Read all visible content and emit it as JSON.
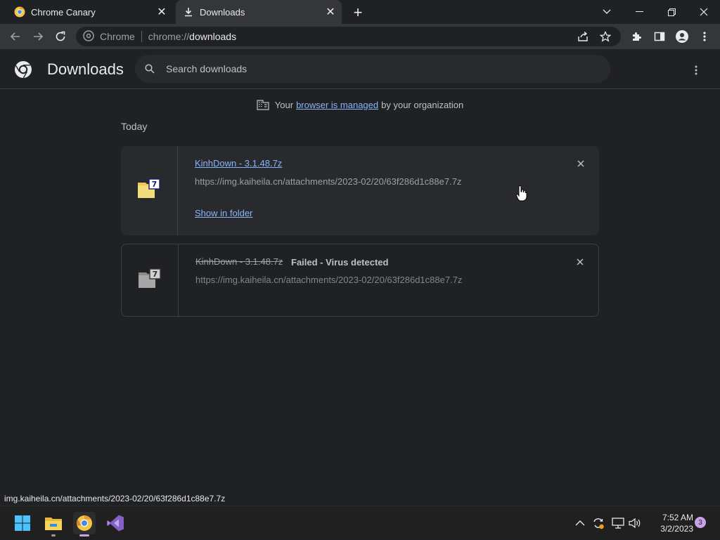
{
  "tabs": [
    {
      "title": "Chrome Canary",
      "favicon": "chrome-canary-icon",
      "active": false
    },
    {
      "title": "Downloads",
      "favicon": "download-icon",
      "active": true
    }
  ],
  "omnibox": {
    "site_label": "Chrome",
    "url_scheme": "chrome://",
    "url_host": "downloads"
  },
  "header": {
    "title": "Downloads",
    "search_placeholder": "Search downloads"
  },
  "managed": {
    "prefix": "Your",
    "link": "browser is managed",
    "suffix": "by your organization"
  },
  "section_label": "Today",
  "downloads": [
    {
      "file_name": "KinhDown - 3.1.48.7z",
      "url": "https://img.kaiheila.cn/attachments/2023-02/20/63f286d1c88e7.7z",
      "action": "Show in folder",
      "status": ""
    },
    {
      "file_name": "KinhDown - 3.1.48.7z",
      "url": "https://img.kaiheila.cn/attachments/2023-02/20/63f286d1c88e7.7z",
      "status": "Failed - Virus detected"
    }
  ],
  "status_bar": "img.kaiheila.cn/attachments/2023-02/20/63f286d1c88e7.7z",
  "taskbar": {
    "apps": [
      "windows-start-icon",
      "file-explorer-icon",
      "chrome-canary-icon",
      "visual-studio-icon"
    ],
    "time": "7:52 AM",
    "date": "3/2/2023",
    "notification_count": "3"
  },
  "colors": {
    "accent": "#8ab4f8",
    "background": "#202124",
    "card": "#292a2d"
  }
}
